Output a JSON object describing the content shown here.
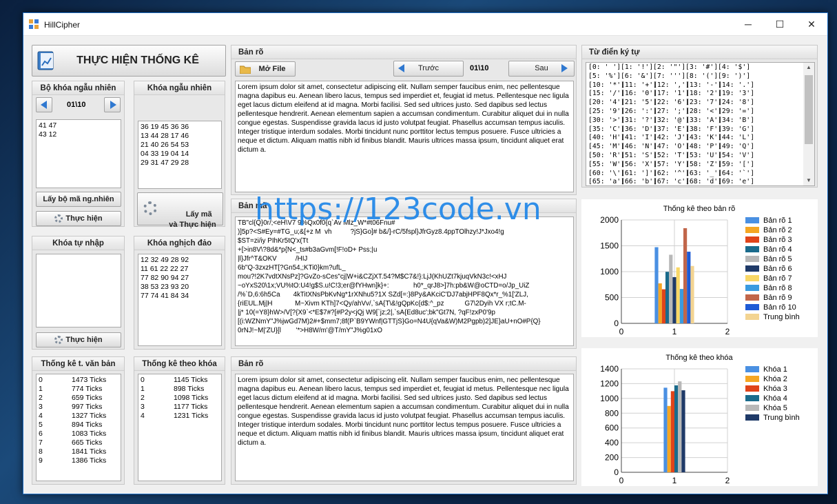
{
  "window": {
    "title": "HillCipher",
    "minimize": "─",
    "maximize": "☐",
    "close": "✕"
  },
  "stats_button": "THỰC HIỆN THỐNG KÊ",
  "random_key_set": {
    "header": "Bộ khóa ngẫu nhiên",
    "counter": "01\\10",
    "content": "41 47\n43 12",
    "btn_get": "Lấy bộ mã ng.nhiên",
    "btn_run": "Thực hiện"
  },
  "random_key": {
    "header": "Khóa ngẫu nhiên",
    "content": "36 19 45 36 36\n13 44 28 17 46\n21 40 26 54 53\n04 33 19 04 14\n29 31 47 29 28",
    "btn": "Lấy mã\nvà Thực hiện"
  },
  "manual_key": {
    "header": "Khóa tự nhập",
    "content": "",
    "btn_run": "Thực hiện"
  },
  "inverse_key": {
    "header": "Khóa nghịch đảo",
    "content": "12 32 49 28 92\n11 61 22 22 27\n77 82 90 94 27\n38 53 23 93 20\n77 74 41 84 34"
  },
  "text_stats": {
    "header": "Thống kê t. văn bản",
    "rows": [
      [
        "0",
        "1473 Ticks"
      ],
      [
        "1",
        "774 Ticks"
      ],
      [
        "2",
        "659 Ticks"
      ],
      [
        "3",
        "997 Ticks"
      ],
      [
        "4",
        "1327 Ticks"
      ],
      [
        "5",
        "894 Ticks"
      ],
      [
        "6",
        "1083 Ticks"
      ],
      [
        "7",
        "665 Ticks"
      ],
      [
        "8",
        "1841 Ticks"
      ],
      [
        "9",
        "1386 Ticks"
      ]
    ]
  },
  "key_stats": {
    "header": "Thống kê theo khóa",
    "rows": [
      [
        "0",
        "1145 Ticks"
      ],
      [
        "1",
        "898 Ticks"
      ],
      [
        "2",
        "1098 Ticks"
      ],
      [
        "3",
        "1177 Ticks"
      ],
      [
        "4",
        "1231 Ticks"
      ]
    ]
  },
  "plaintext": {
    "header": "Bản rõ",
    "open_file": "Mở File",
    "prev": "Trước",
    "counter": "01\\10",
    "next": "Sau",
    "content": "Lorem ipsum dolor sit amet, consectetur adipiscing elit. Nullam semper faucibus enim, nec pellentesque magna dapibus eu. Aenean libero lacus, tempus sed imperdiet et, feugiat id metus. Pellentesque nec ligula eget lacus dictum eleifend at id magna. Morbi facilisi. Sed sed ultrices justo. Sed dapibus sed lectus pellentesque hendrerit. Aenean elementum sapien a accumsan condimentum. Curabitur aliquet dui in nulla congue egestas. Suspendisse gravida lacus id justo volutpat feugiat. Phasellus accumsan tempus iaculis. Integer tristique interdum sodales. Morbi tincidunt nunc porttitor lectus tempus posuere. Fusce ultricies a neque et dictum. Aliquam mattis nibh id finibus blandit. Mauris ultrices massa ipsum, tincidunt aliquet erat dictum a."
  },
  "ciphertext": {
    "header": "Bản mã",
    "content": "TB\"cl{Q}0r/;<eH\\V7 9%Qx0f0{q`Av Mlz_W*#t06Fnu#\n)]5p?<S#Ey=#TG_u;&[+z M  vh          ?jS}Go]# b&/]-rC/5fspl}JfrGyz8.4ppTOlhzy!J*Jxo4!g\n$ST=zi/iy PIhKr5tQ'x(Tt\n+[>in8V\\?8d&*p{N<_ts#b3aGvm[!F!oD+ Pss;|u\n|l}Jfr^T&OKV          /HIJ\n6b\"Q-3zxzHT[?Gn54,;KTi0}km?ufL_\nmou?!2K7vdtXNsPz]?GvZo-sCes\"cj|W+i&CZjXT.54?M$C7&!}:LjJ(KhUZt7kjuqVkN3c!<xHJ\n~oYxS20\\1x;VU%tO:U4!g$S.u!C!3;er@fYHwn]k}+:             h0*_qrJ8>]7h:pb&W@oCTD=o/Jp_UiZ\n/%`D,6:6h5Ca       4kTitXNsPbKvNg*1rXNhu5?1X SZd[=:}8Py&AKciC'DJ7abjHPF8Qx*r_%1['ZLJ,\n{riEUL.Mj|H            M~Xivm KTh]7<Qy/ahVv/,`sA{T\\&!gQpKc{d$:^_pz           G7\\2Dyih VX r;tC.M-\n|j* 10(=Y8}hW>/V[?{X9`<*E$7#?[#P2y<jQj W9[`jz;2|,`sA{Ed8uc';bk\"Gt7N, ?qF!zxP0'9p\n[(i:WZNmY\"J%jwGd7M)2#+$mm7;8f(P`B9YWnf|GTTjS}Go=N4U{qVa&W)M2Pgpb)2]JE}aU+nO#P{Q}\n0rNJ!~M|'ZU}[l        '*>H8W/m'@T/mY\"J%g01xO"
  },
  "decrypted": {
    "header": "Bản rõ",
    "content": "Lorem ipsum dolor sit amet, consectetur adipiscing elit. Nullam semper faucibus enim, nec pellentesque magna dapibus eu. Aenean libero lacus, tempus sed imperdiet et, feugiat id metus. Pellentesque nec ligula eget lacus dictum eleifend at id magna. Morbi facilisi. Sed sed ultrices justo. Sed dapibus sed lectus pellentesque hendrerit. Aenean elementum sapien a accumsan condimentum. Curabitur aliquet dui in nulla congue egestas. Suspendisse gravida lacus id justo volutpat feugiat. Phasellus accumsan tempus iaculis. Integer tristique interdum sodales. Morbi tincidunt nunc porttitor lectus tempus posuere. Fusce ultricies a neque et dictum. Aliquam mattis nibh id finibus blandit. Mauris ultrices massa ipsum, tincidunt aliquet erat dictum a."
  },
  "dictionary": {
    "header": "Từ điển ký tự",
    "rows": [
      [
        "[0: ' ']",
        "[1: '!']",
        "[2: '\"']",
        "[3: '#']",
        "[4: '$']"
      ],
      [
        "[5: '%']",
        "[6: '&']",
        "[7: ''']",
        "[8: '(']",
        "[9: ')']"
      ],
      [
        "[10: '*']",
        "[11: '+']",
        "[12: ',']",
        "[13: '-']",
        "[14: '.']"
      ],
      [
        "[15: '/']",
        "[16: '0']",
        "[17: '1']",
        "[18: '2']",
        "[19: '3']"
      ],
      [
        "[20: '4']",
        "[21: '5']",
        "[22: '6']",
        "[23: '7']",
        "[24: '8']"
      ],
      [
        "[25: '9']",
        "[26: ':']",
        "[27: ';']",
        "[28: '<']",
        "[29: '=']"
      ],
      [
        "[30: '>']",
        "[31: '?']",
        "[32: '@']",
        "[33: 'A']",
        "[34: 'B']"
      ],
      [
        "[35: 'C']",
        "[36: 'D']",
        "[37: 'E']",
        "[38: 'F']",
        "[39: 'G']"
      ],
      [
        "[40: 'H']",
        "[41: 'I']",
        "[42: 'J']",
        "[43: 'K']",
        "[44: 'L']"
      ],
      [
        "[45: 'M']",
        "[46: 'N']",
        "[47: 'O']",
        "[48: 'P']",
        "[49: 'Q']"
      ],
      [
        "[50: 'R']",
        "[51: 'S']",
        "[52: 'T']",
        "[53: 'U']",
        "[54: 'V']"
      ],
      [
        "[55: 'W']",
        "[56: 'X']",
        "[57: 'Y']",
        "[58: 'Z']",
        "[59: '[']"
      ],
      [
        "[60: '\\']",
        "[61: ']']",
        "[62: '^']",
        "[63: '_']",
        "[64: '`']"
      ],
      [
        "[65: 'a']",
        "[66: 'b']",
        "[67: 'c']",
        "[68: 'd']",
        "[69: 'e']"
      ]
    ]
  },
  "watermark": "https://123code.vn",
  "chart_data": [
    {
      "type": "bar",
      "title": "Thống kê theo bản rõ",
      "x_ticks": [
        "0",
        "1",
        "2"
      ],
      "y_ticks": [
        "0",
        "500",
        "1000",
        "1500",
        "2000"
      ],
      "ylim": [
        0,
        2000
      ],
      "xlim": [
        0,
        2
      ],
      "series": [
        {
          "name": "Bản rõ 1",
          "value": 1473,
          "color": "#4a90e2"
        },
        {
          "name": "Bản rõ 2",
          "value": 774,
          "color": "#f5a623"
        },
        {
          "name": "Bản rõ 3",
          "value": 659,
          "color": "#e0441a"
        },
        {
          "name": "Bản rõ 4",
          "value": 997,
          "color": "#1a6b8c"
        },
        {
          "name": "Bản rõ 5",
          "value": 1327,
          "color": "#b8b8b8"
        },
        {
          "name": "Bản rõ 6",
          "value": 894,
          "color": "#1f3a68"
        },
        {
          "name": "Bản rõ 7",
          "value": 1083,
          "color": "#f8d766"
        },
        {
          "name": "Bản rõ 8",
          "value": 665,
          "color": "#3a9be0"
        },
        {
          "name": "Bản rõ 9",
          "value": 1841,
          "color": "#c1664a"
        },
        {
          "name": "Bản rõ 10",
          "value": 1386,
          "color": "#1e5bd6"
        },
        {
          "name": "Trung bình",
          "value": 1110,
          "color": "#f3d492"
        }
      ]
    },
    {
      "type": "bar",
      "title": "Thống kê theo khóa",
      "x_ticks": [
        "0",
        "1",
        "2"
      ],
      "y_ticks": [
        "0",
        "200",
        "400",
        "600",
        "800",
        "1000",
        "1200",
        "1400"
      ],
      "ylim": [
        0,
        1400
      ],
      "xlim": [
        0,
        2
      ],
      "series": [
        {
          "name": "Khóa 1",
          "value": 1145,
          "color": "#4a90e2"
        },
        {
          "name": "Khóa 2",
          "value": 898,
          "color": "#f5a623"
        },
        {
          "name": "Khóa 3",
          "value": 1098,
          "color": "#e0441a"
        },
        {
          "name": "Khóa 4",
          "value": 1177,
          "color": "#1a6b8c"
        },
        {
          "name": "Khóa 5",
          "value": 1231,
          "color": "#b8b8b8"
        },
        {
          "name": "Trung bình",
          "value": 1110,
          "color": "#1f3a68"
        }
      ]
    }
  ]
}
